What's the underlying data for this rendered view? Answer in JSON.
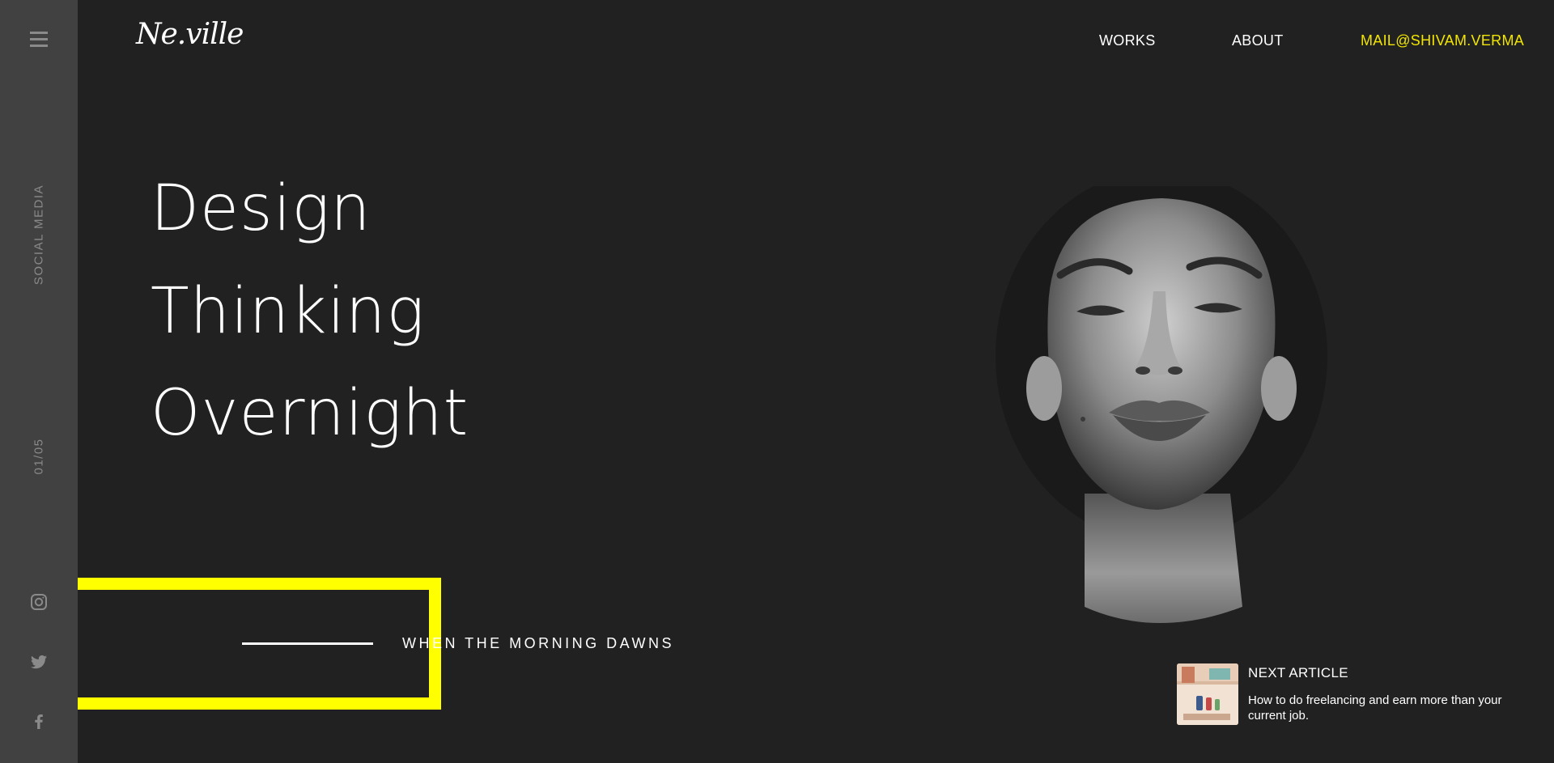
{
  "sidebar": {
    "menu_icon": "hamburger-menu-icon",
    "social_label": "SOCIAL MEDIA",
    "slide_counter": "01/05",
    "social_icons": [
      "instagram-icon",
      "twitter-icon",
      "facebook-icon"
    ]
  },
  "header": {
    "logo": "Ne.ville",
    "nav": {
      "works": "WORKS",
      "about": "ABOUT",
      "mail": "MAIL@SHIVAM.VERMA"
    }
  },
  "hero": {
    "headline_lines": [
      "Design",
      "Thinking",
      "Overnight"
    ],
    "tagline": "WHEN THE MORNING DAWNS"
  },
  "next_article": {
    "label": "NEXT ARTICLE",
    "title": "How to do freelancing and earn more than your current job."
  },
  "colors": {
    "background": "#212121",
    "sidebar": "#414141",
    "accent_yellow": "#ffff00",
    "mail_link": "#f2e600",
    "muted_icon": "#8a8a8a"
  }
}
